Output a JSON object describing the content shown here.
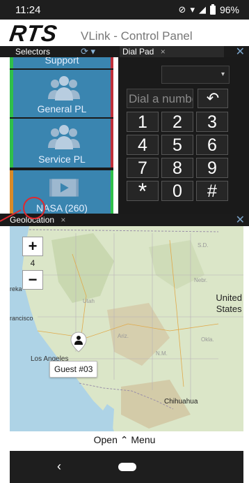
{
  "status_bar": {
    "time": "11:24",
    "battery": "96%"
  },
  "header": {
    "logo": "RTS",
    "title": "VLink - Control Panel"
  },
  "tabs": {
    "selectors": "Selectors",
    "dial_pad": "Dial Pad",
    "geolocation": "Geolocation",
    "close_glyph": "×"
  },
  "selectors": {
    "items": [
      {
        "label": "Support"
      },
      {
        "label": "General PL"
      },
      {
        "label": "Service PL"
      },
      {
        "label": "NASA (260)"
      }
    ]
  },
  "dial_pad": {
    "input_placeholder": "Dial a number",
    "select_value": "",
    "keys": [
      "1",
      "2",
      "3",
      "4",
      "5",
      "6",
      "7",
      "8",
      "9",
      "*",
      "0",
      "#"
    ]
  },
  "map": {
    "zoom_level": "4",
    "zoom_in": "+",
    "zoom_out": "−",
    "labels": {
      "united_states": "United\nStates",
      "san_francisco": "rancisco",
      "los_angeles": "Los Angeles",
      "chihuahua": "Chihuahua",
      "exa": "reka"
    },
    "marker_label": "Guest #03"
  },
  "bottom": {
    "open_menu": "Open ⌃ Menu"
  },
  "colors": {
    "tile_blue": "#3a85b0",
    "accent_green": "#2fbf4a",
    "accent_red": "#c0303a",
    "annotation_red": "#e0282e"
  }
}
